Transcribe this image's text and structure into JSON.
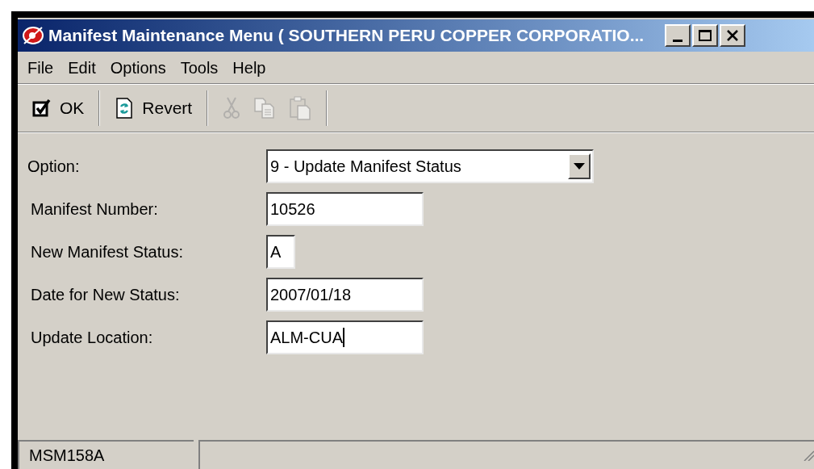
{
  "window": {
    "title": "Manifest Maintenance Menu ( SOUTHERN PERU COPPER CORPORATIO..."
  },
  "menu": [
    "File",
    "Edit",
    "Options",
    "Tools",
    "Help"
  ],
  "toolbar": [
    {
      "kind": "ok",
      "label": "OK",
      "disabled": false
    },
    {
      "kind": "separator"
    },
    {
      "kind": "revert",
      "label": "Revert",
      "disabled": false
    },
    {
      "kind": "separator"
    },
    {
      "kind": "cut",
      "disabled": true
    },
    {
      "kind": "copy",
      "disabled": true
    },
    {
      "kind": "paste",
      "disabled": true
    },
    {
      "kind": "separator"
    }
  ],
  "form": [
    {
      "kind": "dropdown",
      "label": "Option:",
      "value": "9 - Update Manifest Status"
    },
    {
      "kind": "text",
      "label": "Manifest Number:",
      "value": "10526"
    },
    {
      "kind": "char",
      "label": "New Manifest Status:",
      "value": "A"
    },
    {
      "kind": "text",
      "label": "Date for New Status:",
      "value": "2007/01/18"
    },
    {
      "kind": "text",
      "label": "Update Location:",
      "value": "ALM-CUA",
      "focused": true
    }
  ],
  "status_bar": {
    "panes": [
      "MSM158A"
    ]
  }
}
